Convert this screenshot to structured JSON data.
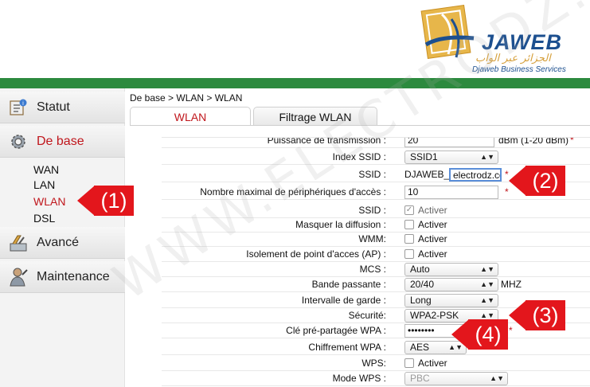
{
  "brand": {
    "name": "JAWEB",
    "arabic": "الجزائر عبر الواب",
    "subtitle": "Djaweb Business Services"
  },
  "sidebar": {
    "menus": [
      {
        "label": "Statut",
        "icon": "status-icon"
      },
      {
        "label": "De base",
        "icon": "gear-icon",
        "active": true
      },
      {
        "label": "Avancé",
        "icon": "tools-icon"
      },
      {
        "label": "Maintenance",
        "icon": "user-icon"
      }
    ],
    "submenu": [
      "WAN",
      "LAN",
      "WLAN",
      "DSL"
    ],
    "active_submenu": "WLAN"
  },
  "breadcrumb": "De base > WLAN > WLAN",
  "tabs": [
    {
      "label": "WLAN",
      "active": true
    },
    {
      "label": "Filtrage WLAN",
      "active": false
    }
  ],
  "form": {
    "power_label": "Puissance de transmission :",
    "power_value": "20",
    "power_hint": "dBm (1-20 dBm)",
    "ssid_index_label": "Index SSID :",
    "ssid_index_value": "SSID1",
    "ssid_label": "SSID :",
    "ssid_prefix": "DJAWEB_",
    "ssid_value": "electrodz.com",
    "max_devices_label": "Nombre maximal de périphériques d'accès :",
    "max_devices_value": "10",
    "ssid_enable_label": "SSID :",
    "hide_label": "Masquer la diffusion :",
    "wmm_label": "WMM:",
    "isolation_label": "Isolement de point d'acces (AP) :",
    "mcs_label": "MCS :",
    "mcs_value": "Auto",
    "bandwidth_label": "Bande passante :",
    "bandwidth_value": "20/40",
    "bandwidth_unit": "MHZ",
    "guard_label": "Intervalle de garde :",
    "guard_value": "Long",
    "security_label": "Sécurité:",
    "security_value": "WPA2-PSK",
    "psk_label": "Clé pré-partagée WPA :",
    "psk_value": "••••••••",
    "encryption_label": "Chiffrement WPA :",
    "encryption_value": "AES",
    "wps_label": "WPS:",
    "wps_mode_label": "Mode WPS :",
    "wps_mode_value": "PBC",
    "activate_label": "Activer",
    "required_mark": "*"
  },
  "callouts": [
    "(1)",
    "(2)",
    "(3)",
    "(4)"
  ],
  "watermark": "WWW.ELECTRODZ.COM",
  "colors": {
    "accent_red": "#c0161c",
    "callout_red": "#e3161c",
    "header_green": "#2c8a3e",
    "brand_blue": "#1c4f8f",
    "brand_gold": "#d6a03c"
  }
}
